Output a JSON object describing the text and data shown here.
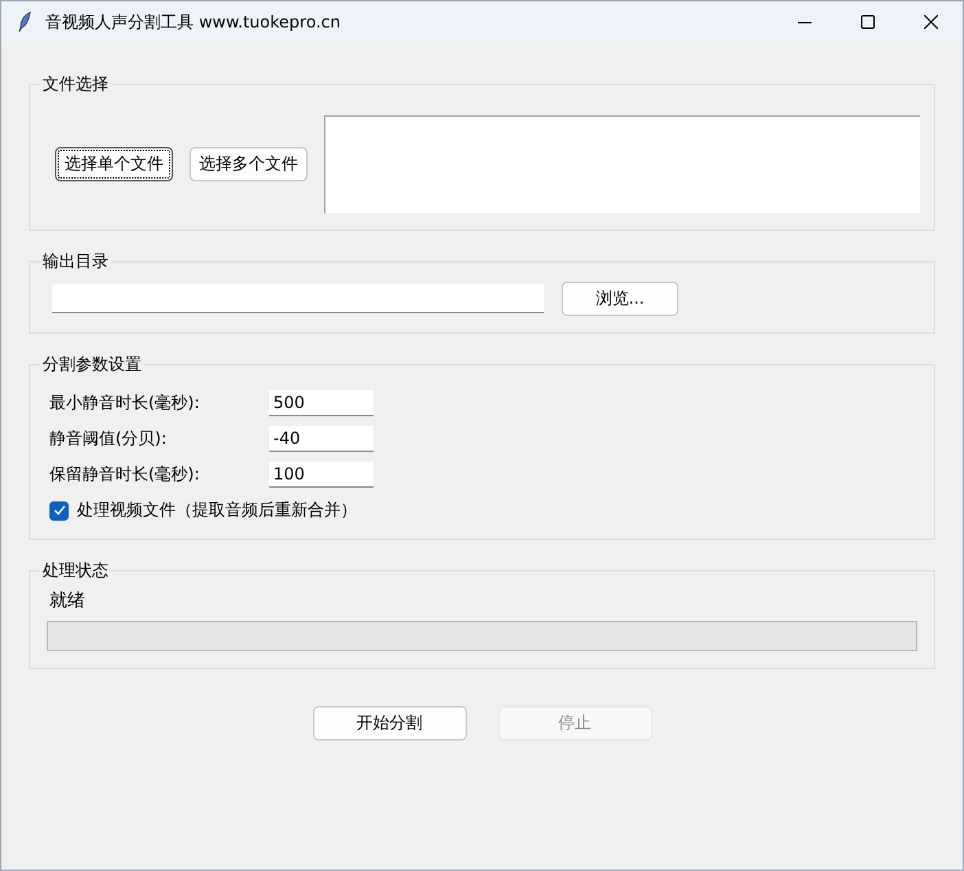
{
  "window": {
    "title": "音视频人声分割工具 www.tuokepro.cn"
  },
  "file_section": {
    "title": "文件选择",
    "buttons": [
      {
        "label": "选择单个文件",
        "focused": true
      },
      {
        "label": "选择多个文件",
        "focused": false
      }
    ]
  },
  "output_section": {
    "title": "输出目录",
    "browse_button": "浏览..."
  },
  "params_section": {
    "title": "分割参数设置",
    "fields": [
      {
        "label": "最小静音时长(毫秒):",
        "value": "500"
      },
      {
        "label": "静音阈值(分贝):",
        "value": "-40"
      },
      {
        "label": "保留静音时长(毫秒):",
        "value": "100"
      }
    ],
    "checkbox": {
      "label": "处理视频文件（提取音频后重新合并）",
      "checked": true
    }
  },
  "status_section": {
    "title": "处理状态",
    "status": "就绪",
    "progress": {
      "level": 0
    }
  },
  "actions": [
    {
      "label": "开始分割",
      "disabled": false
    },
    {
      "label": "停止",
      "disabled": true
    }
  ]
}
